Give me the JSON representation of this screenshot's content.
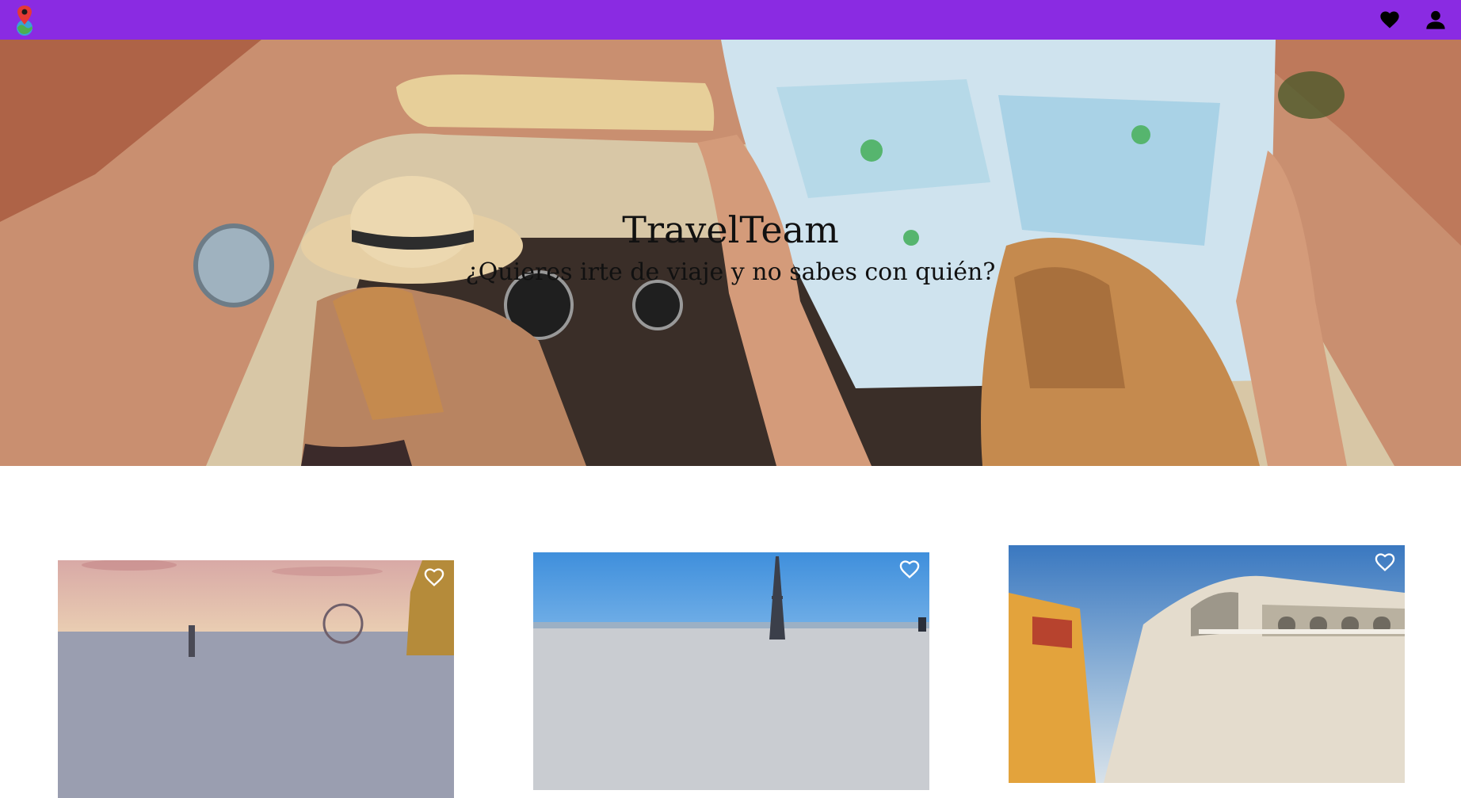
{
  "navbar": {
    "logo_icon": "map-pin-globe-icon",
    "favorites_icon": "heart-icon",
    "profile_icon": "user-icon",
    "background": "#8a2be2"
  },
  "hero": {
    "title": "TravelTeam",
    "subtitle": "¿Quieres irte de viaje y no sabes con quién?",
    "image": "two-travellers-in-convertible-with-map"
  },
  "destinations": [
    {
      "image": "london-skyline",
      "favorite_icon": "heart-outline-icon"
    },
    {
      "image": "paris-eiffel-tower",
      "favorite_icon": "heart-outline-icon"
    },
    {
      "image": "venice-rialto-bridge",
      "favorite_icon": "heart-outline-icon"
    }
  ]
}
